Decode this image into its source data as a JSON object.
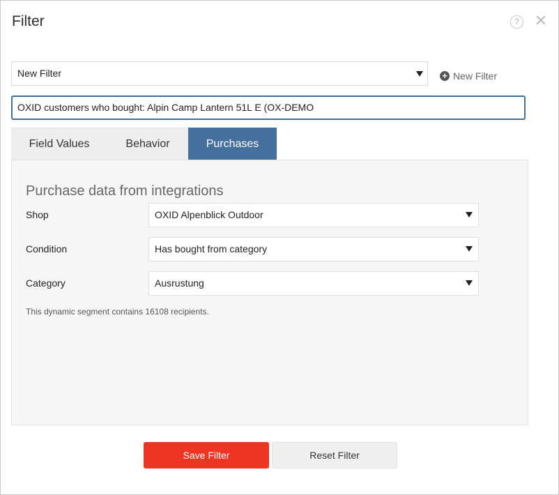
{
  "dialog": {
    "title": "Filter",
    "help_icon": "question-circle-icon",
    "help_glyph": "?",
    "close_icon": "close-icon",
    "close_glyph": "✕"
  },
  "filter_select": {
    "value": "New Filter"
  },
  "new_filter_button": {
    "icon": "plus-circle-icon",
    "glyph": "+",
    "label": "New Filter"
  },
  "filter_name": {
    "value": "OXID customers who bought: Alpin Camp Lantern 51L E (OX-DEMO"
  },
  "tabs": [
    {
      "label": "Field Values",
      "active": false
    },
    {
      "label": "Behavior",
      "active": false
    },
    {
      "label": "Purchases",
      "active": true
    }
  ],
  "panel": {
    "heading": "Purchase data from integrations",
    "rows": [
      {
        "label": "Shop",
        "value": "OXID Alpenblick Outdoor"
      },
      {
        "label": "Condition",
        "value": "Has bought from category"
      },
      {
        "label": "Category",
        "value": "Ausrustung"
      }
    ],
    "note": "This dynamic segment contains 16108 recipients."
  },
  "footer": {
    "save_label": "Save Filter",
    "reset_label": "Reset Filter"
  },
  "colors": {
    "accent_tab": "#456f9c",
    "save_button": "#ee3523",
    "input_focus_border": "#3d6f9e"
  }
}
